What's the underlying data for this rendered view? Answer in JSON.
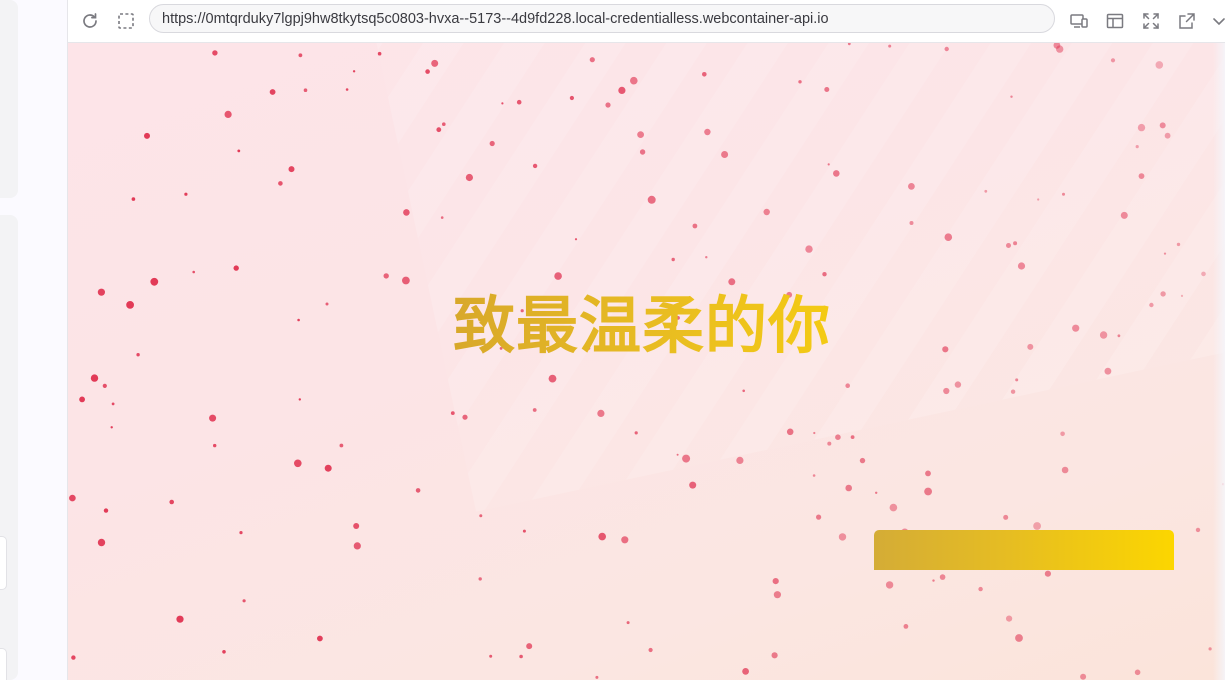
{
  "browser": {
    "url": "https://0mtqrduky7lgpj9hw8tkytsq5c0803-hvxa--5173--4d9fd228.local-credentialless.webcontainer-api.io",
    "icons": {
      "reload": "reload-icon",
      "select_element": "select-element-icon",
      "devices": "devices-icon",
      "layout": "layout-icon",
      "fullscreen": "fullscreen-icon",
      "open_external": "open-external-icon",
      "more": "chevron-down-icon"
    }
  },
  "preview": {
    "headline": "致最温柔的你",
    "colors": {
      "headline_gold_start": "#d8a82a",
      "headline_gold_end": "#f5cc12",
      "particle": "#e0304f",
      "background": "#fce4e6"
    }
  }
}
